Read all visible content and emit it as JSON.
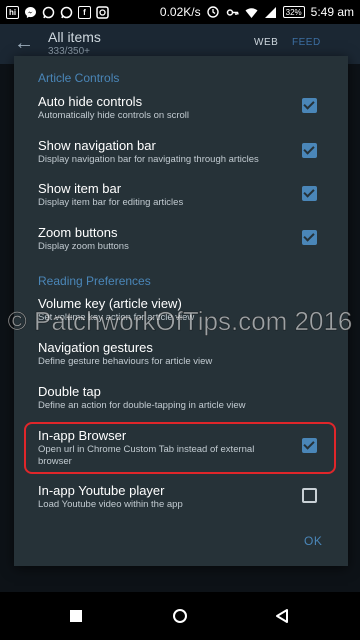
{
  "status_bar": {
    "left_icons": [
      "hike-icon",
      "facebook-messenger-icon",
      "whatsapp-icon",
      "whatsapp-icon",
      "facebook-icon",
      "instagram-icon"
    ],
    "network_speed": "0.02K/s",
    "battery": "32%",
    "time": "5:49 am"
  },
  "app_bar": {
    "title": "All items",
    "subtitle": "333/350+",
    "tabs": [
      "WEB",
      "FEED"
    ],
    "active_tab": "FEED"
  },
  "dialog": {
    "section_article_controls": "Article Controls",
    "items": [
      {
        "title": "Auto hide controls",
        "summary": "Automatically hide controls on scroll",
        "checked": true
      },
      {
        "title": "Show navigation bar",
        "summary": "Display navigation bar for navigating through articles",
        "checked": true
      },
      {
        "title": "Show item bar",
        "summary": "Display item bar for editing articles",
        "checked": true
      },
      {
        "title": "Zoom buttons",
        "summary": "Display zoom buttons",
        "checked": true
      }
    ],
    "section_reading_preferences": "Reading Preferences",
    "reading_items": [
      {
        "title": "Volume key (article view)",
        "summary": "Set volume key action for article view"
      },
      {
        "title": "Navigation gestures",
        "summary": "Define gesture behaviours for article view"
      },
      {
        "title": "Double tap",
        "summary": "Define an action for double-tapping in article view"
      },
      {
        "title": "In-app Browser",
        "summary": "Open url in Chrome Custom Tab instead of external browser",
        "checked": true
      },
      {
        "title": "In-app Youtube player",
        "summary": "Load Youtube video within the app",
        "checked": false
      }
    ],
    "ok_label": "OK"
  },
  "watermark": "© PatchworkOfTips.com 2016",
  "colors": {
    "accent": "#4a86b8",
    "dialog_bg": "#263238",
    "highlight": "#e0262a"
  }
}
